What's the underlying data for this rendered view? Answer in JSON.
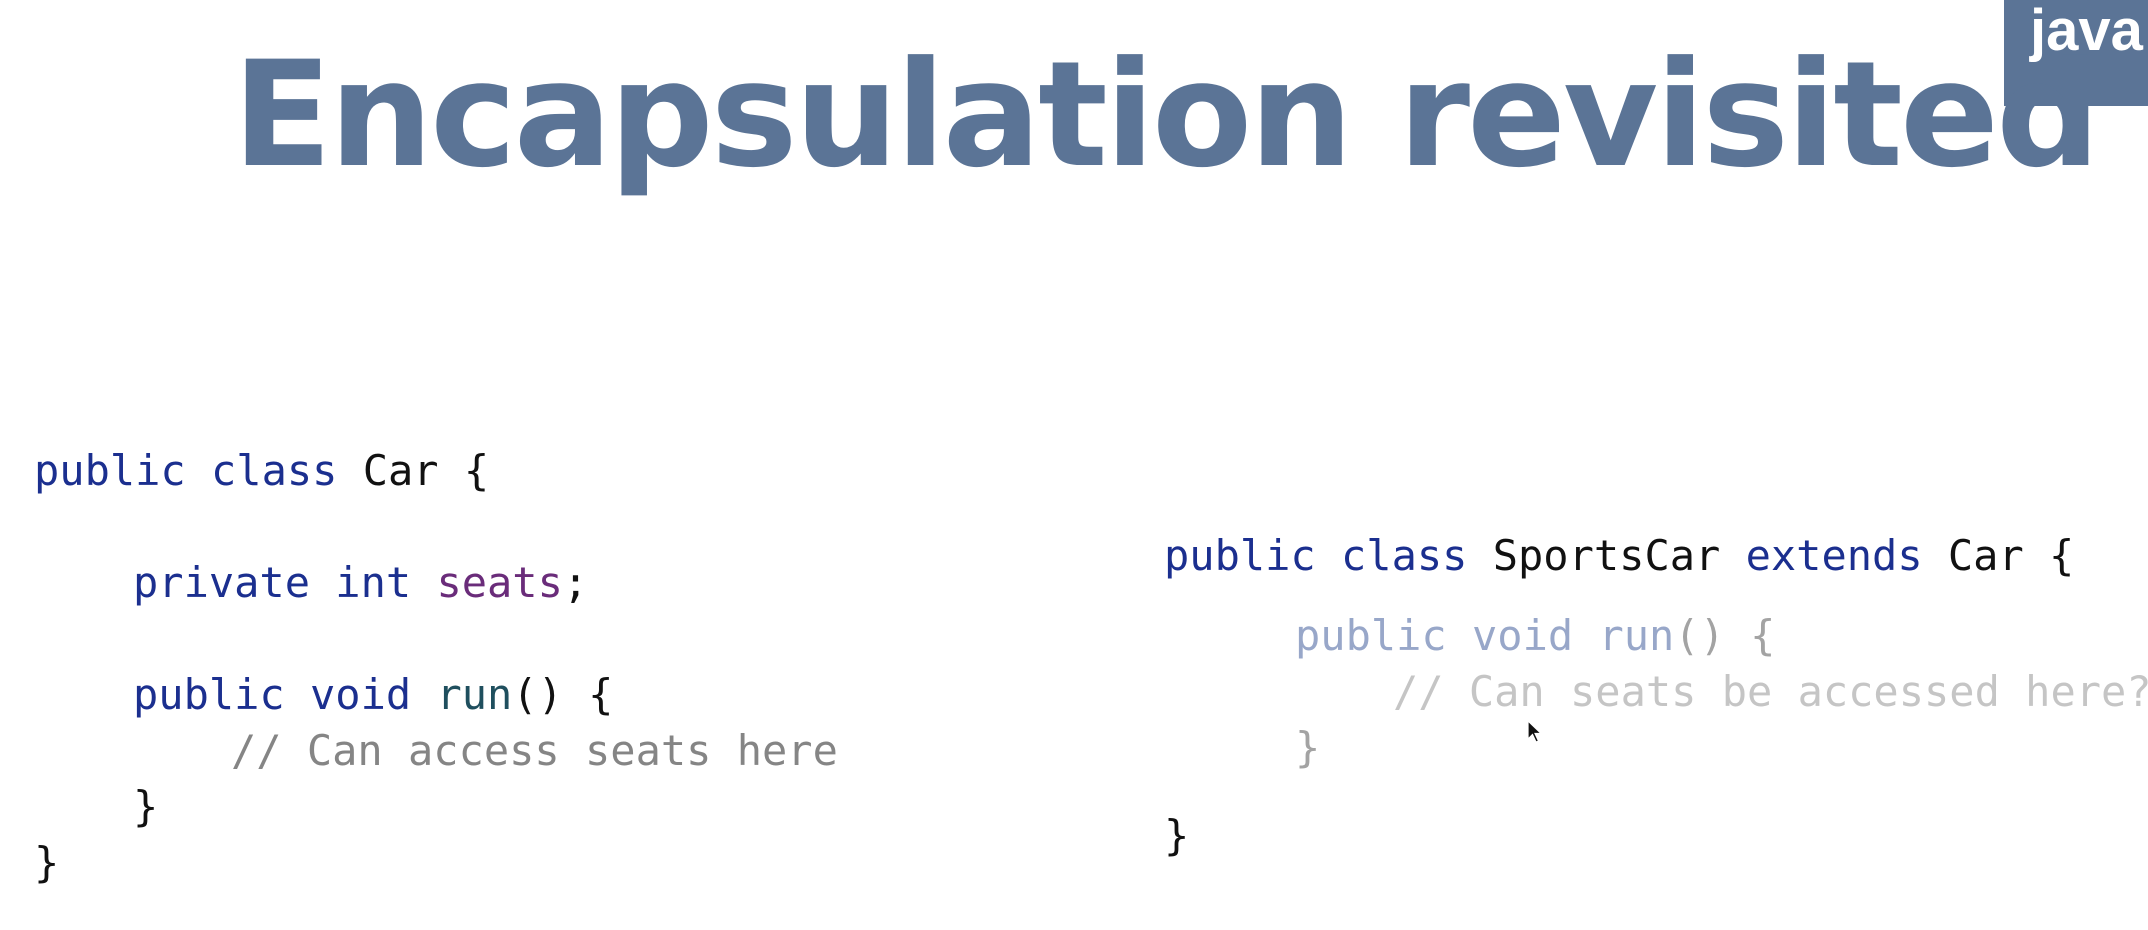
{
  "slide": {
    "title": "Encapsulation revisited",
    "badge": "java"
  },
  "left_code": {
    "line1": {
      "kw": "public class ",
      "cls": "Car",
      "pun": " {"
    },
    "line2": {
      "kw": "private int ",
      "fld": "seats",
      "pun": ";"
    },
    "line3": {
      "kw": "public void ",
      "mth": "run",
      "pun": "() {"
    },
    "line4": {
      "cmt": "// Can access seats here"
    },
    "line5": {
      "pun": "}"
    },
    "line6": {
      "pun": "}"
    }
  },
  "right_code": {
    "line1": {
      "kw1": "public class ",
      "cls1": "SportsCar",
      "kw2": " extends ",
      "cls2": "Car",
      "pun": " {"
    },
    "line2": {
      "kw": "public void ",
      "mth": "run",
      "pun": "() {"
    },
    "line3": {
      "cmt": "// Can seats be accessed here?"
    },
    "line4": {
      "pun": "}"
    },
    "line5": {
      "pun": "}"
    }
  },
  "colors": {
    "title": "#5b7496",
    "keyword": "#1b2f8f",
    "field": "#6a2c7a",
    "method": "#1f4f5e",
    "comment": "#858585"
  },
  "icons": {
    "cursor": "mouse-pointer-icon"
  }
}
